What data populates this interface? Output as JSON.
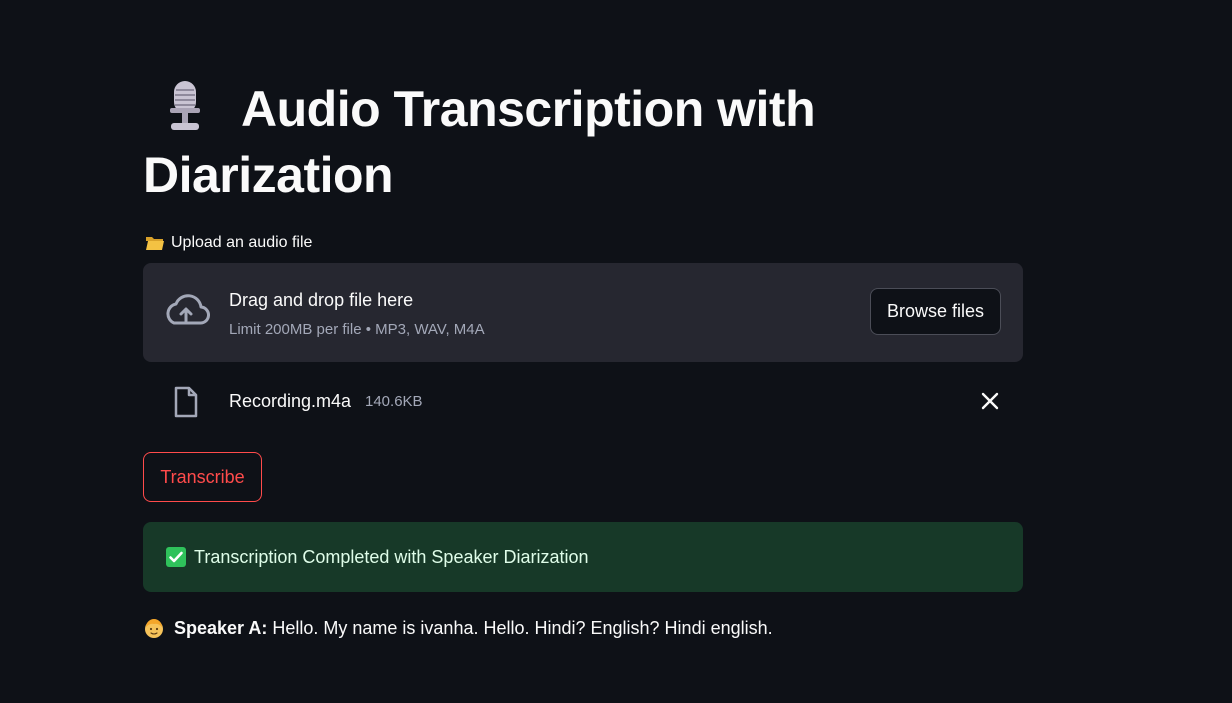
{
  "header": {
    "title": "Audio Transcription with Diarization",
    "title_icon": "microphone-icon"
  },
  "uploader": {
    "label": "Upload an audio file",
    "label_icon": "open-folder-icon",
    "drop_title": "Drag and drop file here",
    "drop_limit": "Limit 200MB per file • MP3, WAV, M4A",
    "browse_label": "Browse files",
    "cloud_icon": "cloud-upload-icon"
  },
  "uploaded_file": {
    "name": "Recording.m4a",
    "size": "140.6KB",
    "icon": "file-icon",
    "remove_icon": "close-icon"
  },
  "actions": {
    "transcribe_label": "Transcribe"
  },
  "status": {
    "message": "Transcription Completed with Speaker Diarization",
    "icon": "check-box-icon"
  },
  "transcript": [
    {
      "speaker": "Speaker A:",
      "text": "Hello. My name is ivanha. Hello. Hindi? English? Hindi english.",
      "icon": "person-icon"
    }
  ],
  "colors": {
    "background": "#0e1117",
    "surface": "#262730",
    "accent": "#ff4b4b",
    "success_bg": "#173928",
    "muted_text": "#a3a8b8"
  }
}
